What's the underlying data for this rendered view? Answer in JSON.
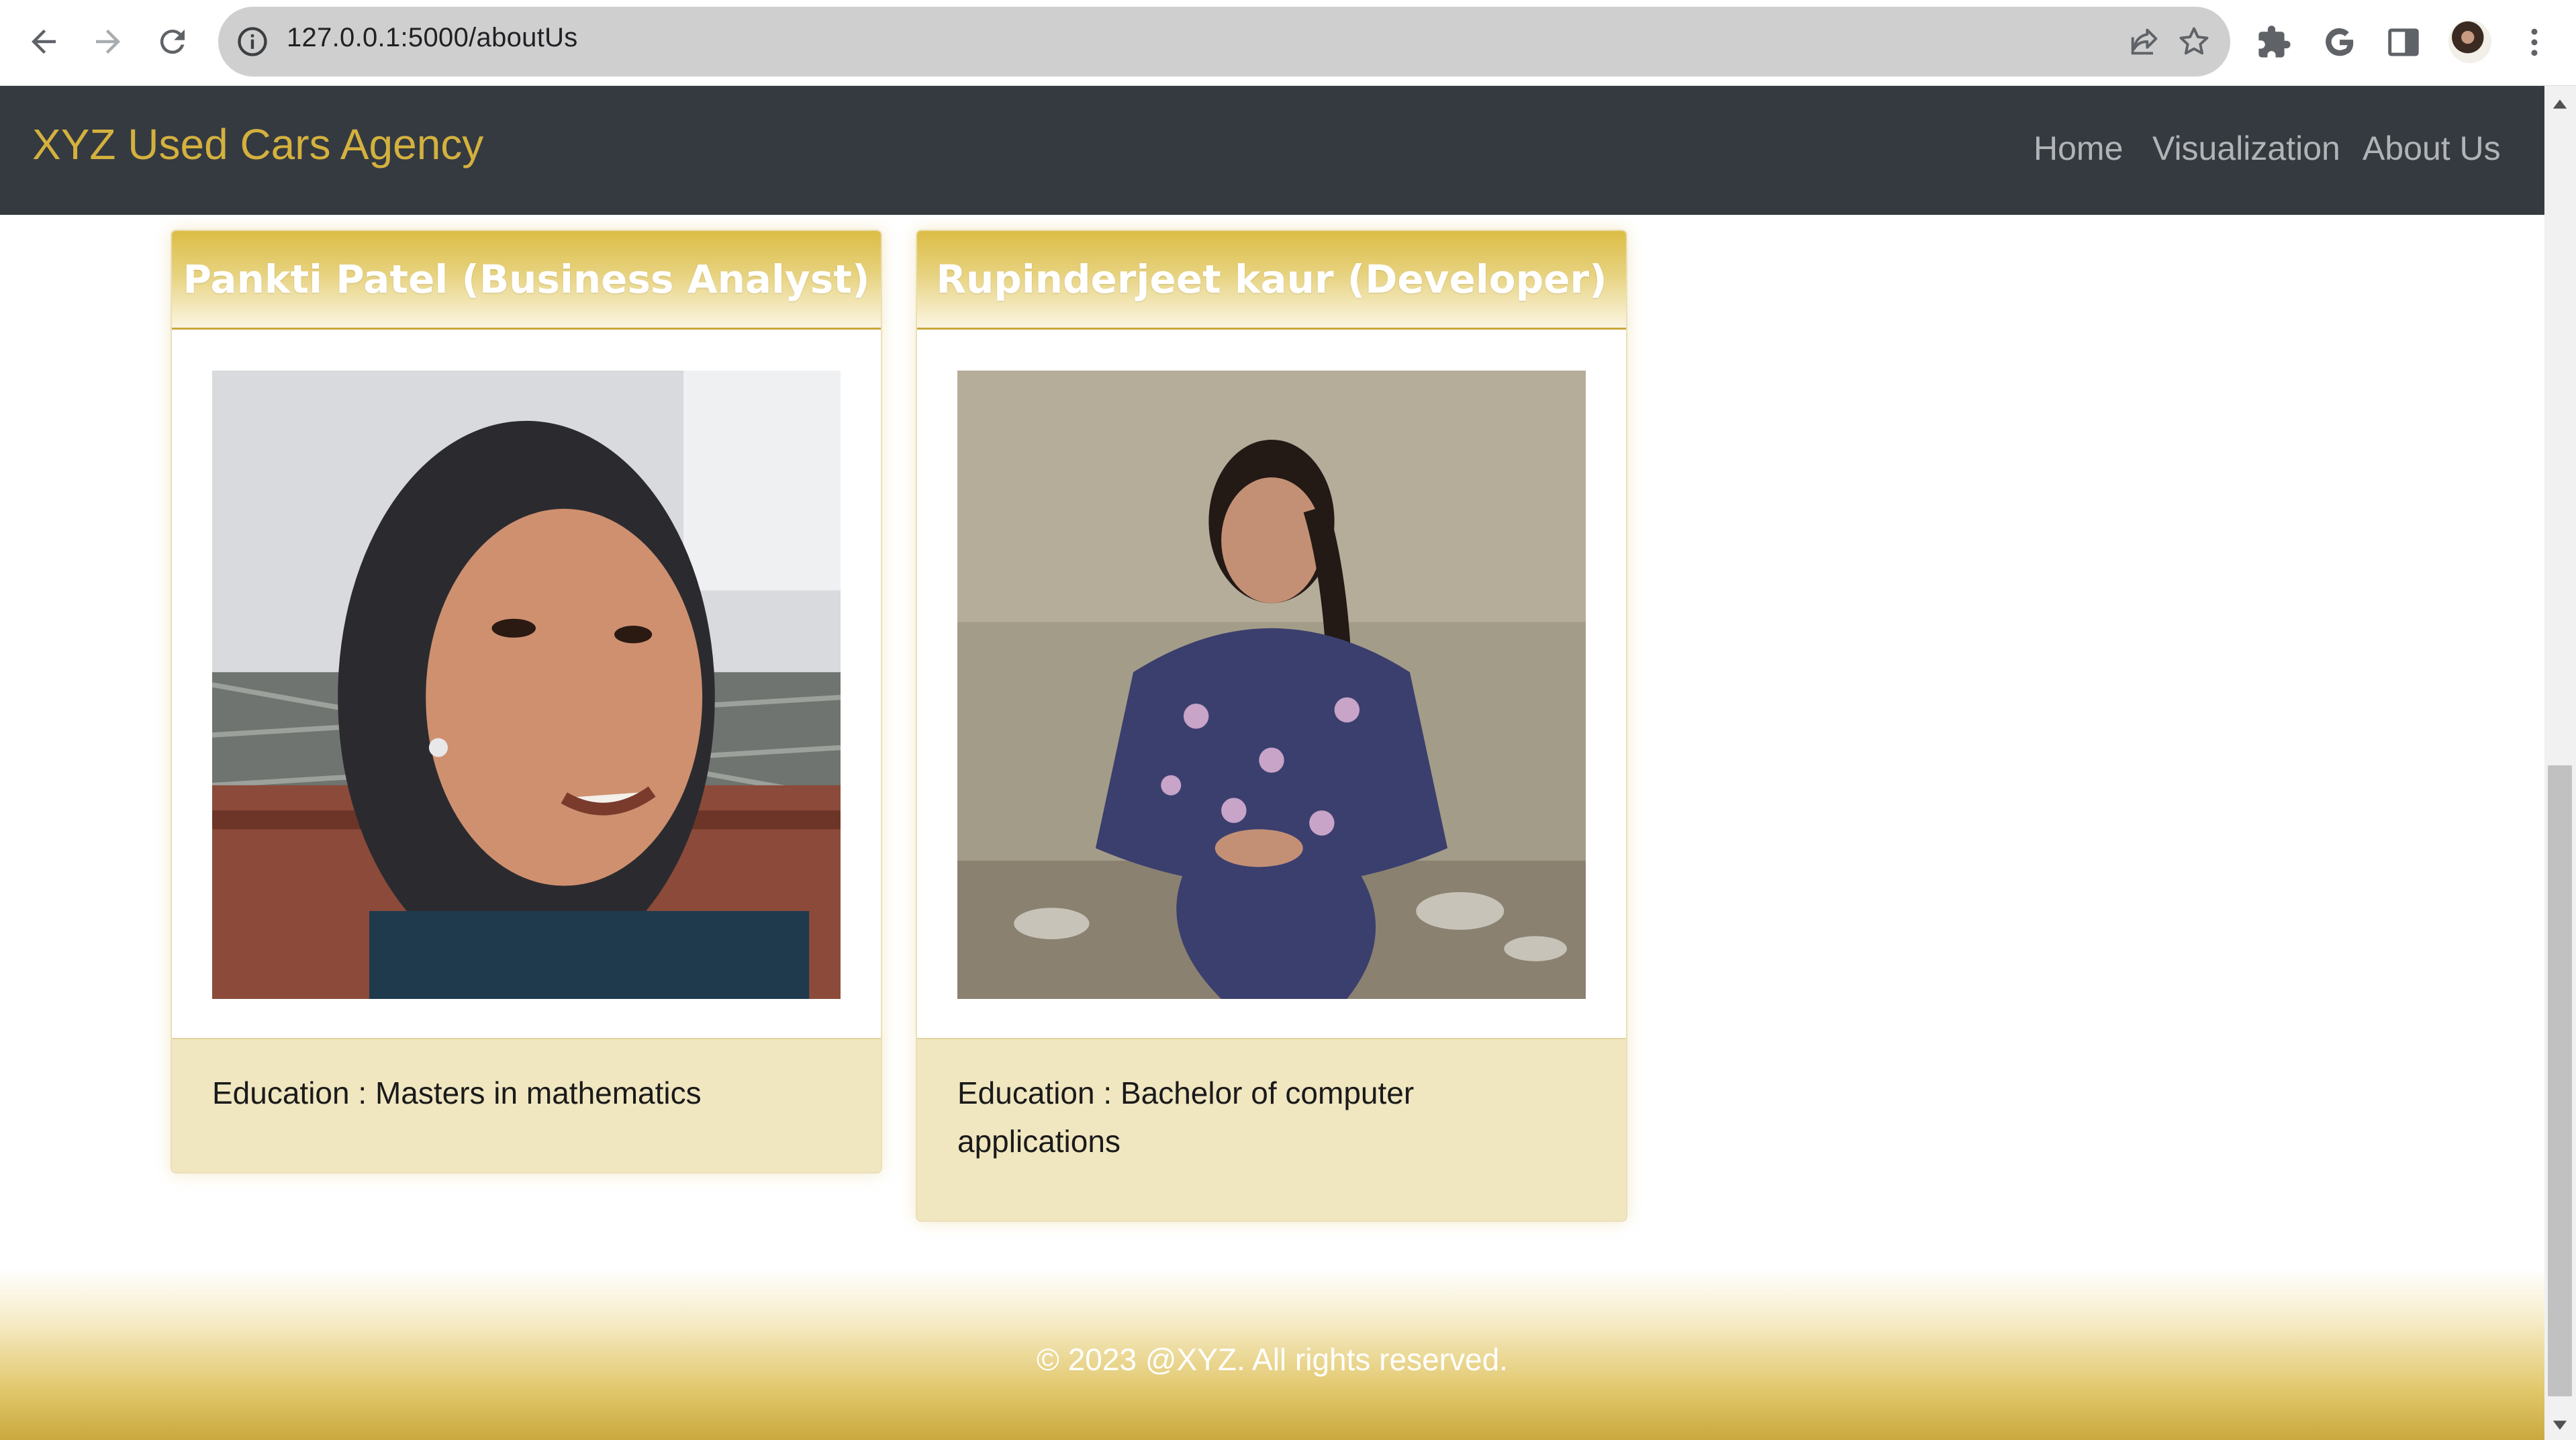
{
  "browser": {
    "url": "127.0.0.1:5000/aboutUs",
    "icons": [
      "back-icon",
      "forward-icon",
      "reload-icon",
      "info-icon",
      "share-icon",
      "star-icon",
      "extensions-icon",
      "google-icon",
      "side-panel-icon",
      "profile-avatar",
      "menu-icon"
    ]
  },
  "navbar": {
    "brand": "XYZ Used Cars Agency",
    "links": [
      "Home",
      "Visualization",
      "About Us"
    ]
  },
  "team": [
    {
      "title": "Pankti Patel (Business Analyst)",
      "education": "Education : Masters in mathematics"
    },
    {
      "title": "Rupinderjeet kaur (Developer)",
      "education": "Education : Bachelor of computer applications"
    }
  ],
  "footer": {
    "copyright": "© 2023 @XYZ. All rights reserved."
  },
  "colors": {
    "navbar_bg": "#343a40",
    "brand": "#d4b13e",
    "card_header_gold": "#dcbd46",
    "card_footer": "#f0e6c0"
  }
}
